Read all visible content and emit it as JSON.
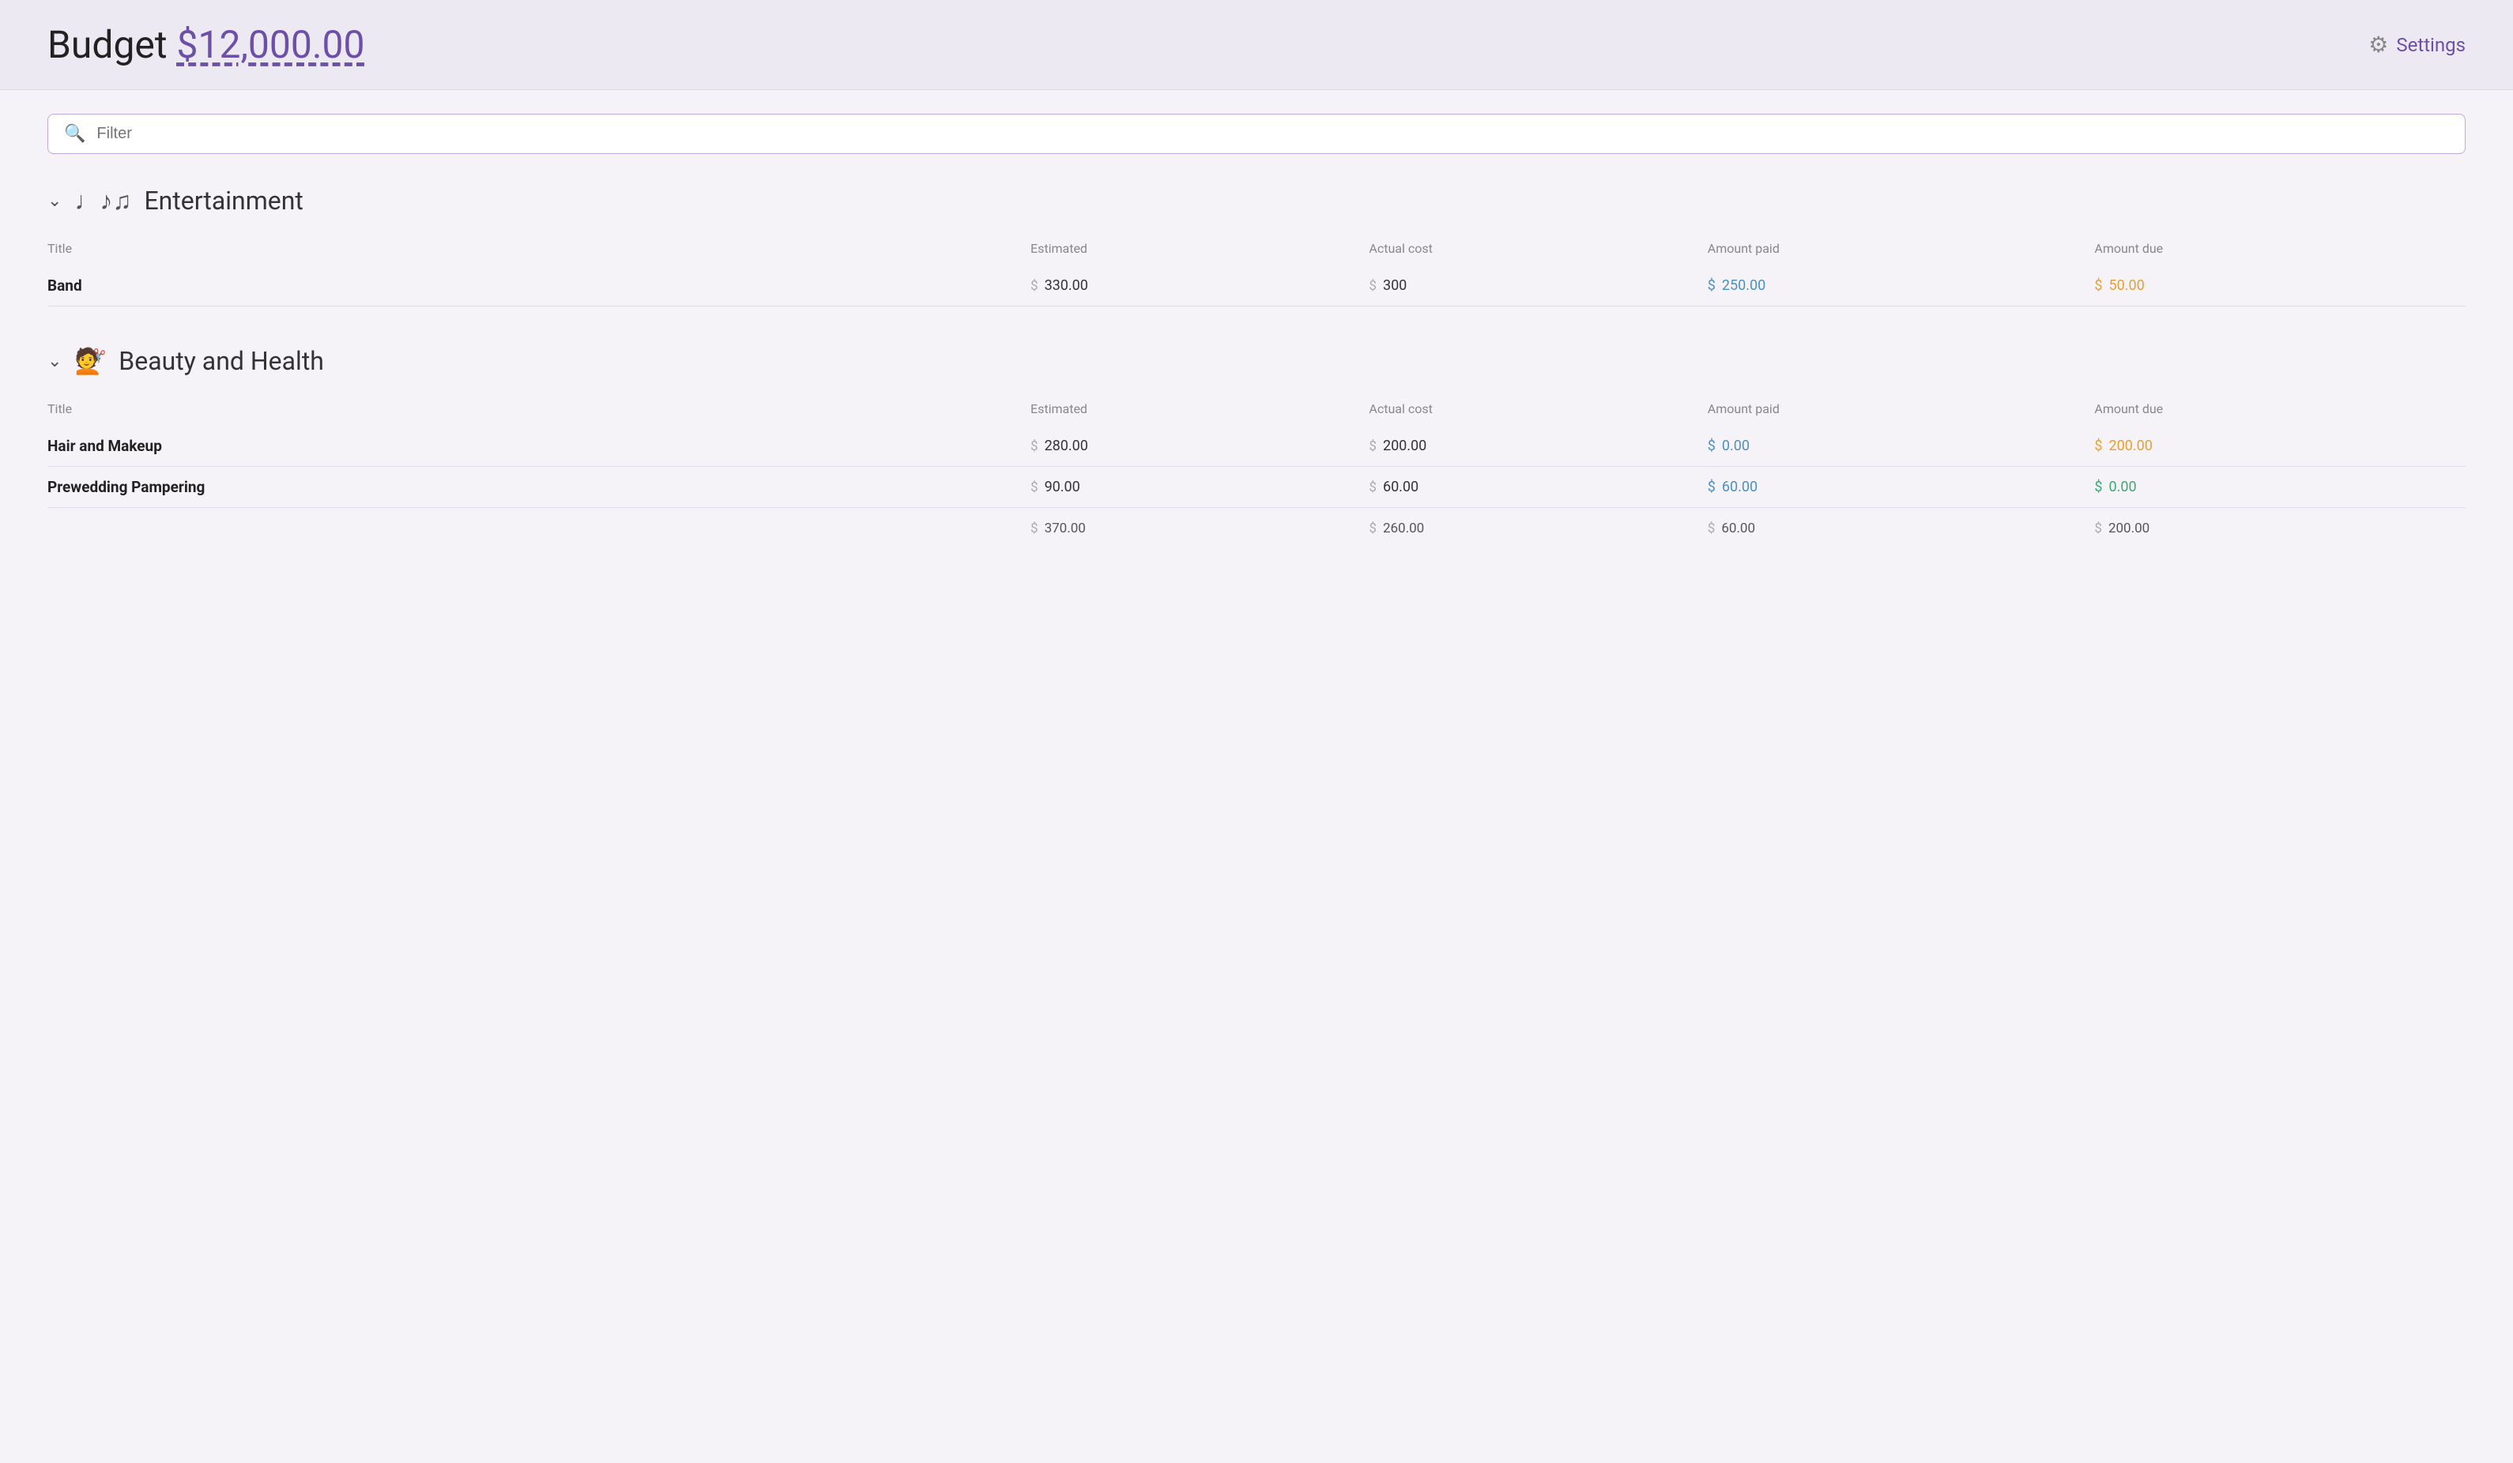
{
  "header": {
    "title": "Budget",
    "amount": "$12,000.00",
    "settings_label": "Settings"
  },
  "filter": {
    "placeholder": "Filter"
  },
  "categories": [
    {
      "id": "entertainment",
      "icon": "♩♪♫",
      "title": "Entertainment",
      "columns": [
        "Title",
        "Estimated",
        "Actual cost",
        "Amount paid",
        "Amount due"
      ],
      "items": [
        {
          "title": "Band",
          "estimated": "330.00",
          "actual": "300",
          "paid": "250.00",
          "paid_color": "blue",
          "due": "50.00",
          "due_color": "orange"
        }
      ],
      "totals": null
    },
    {
      "id": "beauty",
      "icon": "💇",
      "title": "Beauty and Health",
      "columns": [
        "Title",
        "Estimated",
        "Actual cost",
        "Amount paid",
        "Amount due"
      ],
      "items": [
        {
          "title": "Hair and Makeup",
          "estimated": "280.00",
          "actual": "200.00",
          "paid": "0.00",
          "paid_color": "blue",
          "due": "200.00",
          "due_color": "orange"
        },
        {
          "title": "Prewedding Pampering",
          "estimated": "90.00",
          "actual": "60.00",
          "paid": "60.00",
          "paid_color": "blue",
          "due": "0.00",
          "due_color": "green"
        }
      ],
      "totals": {
        "estimated": "370.00",
        "actual": "260.00",
        "paid": "60.00",
        "due": "200.00"
      }
    }
  ]
}
